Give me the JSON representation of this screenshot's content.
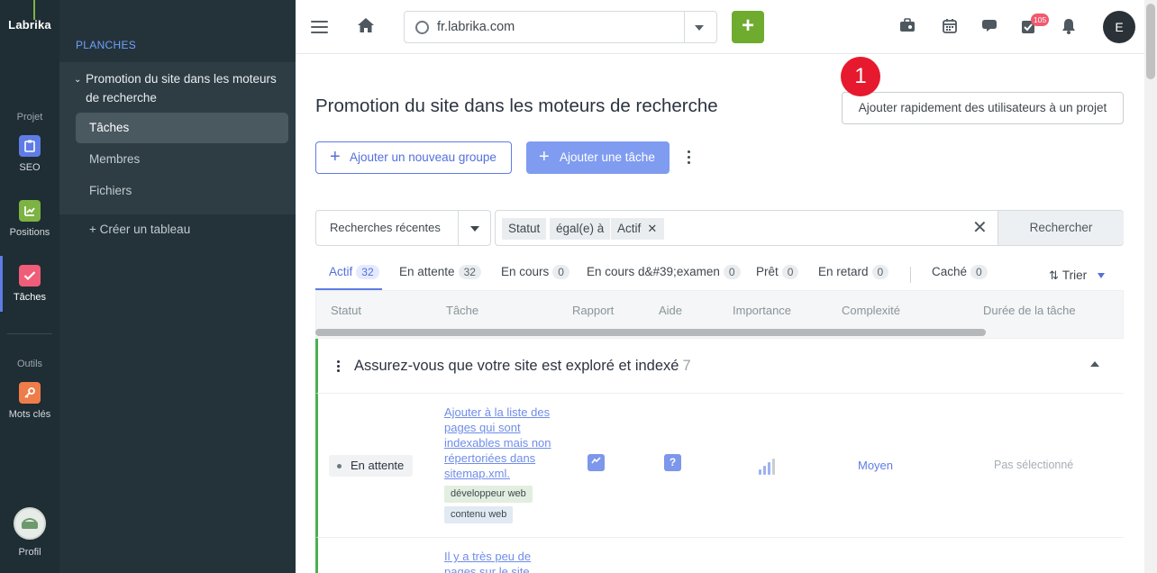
{
  "app": {
    "logo": "Labrika"
  },
  "rail": {
    "section_projet": "Projet",
    "section_outils": "Outils",
    "items": [
      {
        "label": "SEO",
        "color": "#5f7ce6"
      },
      {
        "label": "Positions",
        "color": "#7cb342"
      },
      {
        "label": "Tâches",
        "color": "#ef5d78"
      },
      {
        "label": "Mots clés",
        "color": "#ef7d4a"
      },
      {
        "label": "Profil"
      }
    ]
  },
  "sidebar": {
    "title": "PLANCHES",
    "group_label": "Promotion du site dans les moteurs de recherche",
    "items": [
      {
        "label": "Tâches",
        "active": true
      },
      {
        "label": "Membres"
      },
      {
        "label": "Fichiers"
      }
    ],
    "create_label": "+ Créer un tableau"
  },
  "topbar": {
    "url": "fr.labrika.com",
    "plus_label": "+",
    "notifications_count": "105",
    "user_initial": "E"
  },
  "main": {
    "title": "Promotion du site dans les moteurs de recherche",
    "marker": "1",
    "quick_add_label": "Ajouter rapidement des utilisateurs à un projet",
    "add_group_label": "Ajouter un nouveau groupe",
    "add_task_label": "Ajouter une tâche",
    "recent_searches_label": "Recherches récentes",
    "filter_chips": [
      "Statut",
      "égal(e) à",
      "Actif"
    ],
    "search_label": "Rechercher",
    "tabs": [
      {
        "label": "Actif",
        "count": "32"
      },
      {
        "label": "En attente",
        "count": "32"
      },
      {
        "label": "En cours",
        "count": "0"
      },
      {
        "label": "En cours d&#39;examen",
        "count": "0"
      },
      {
        "label": "Prêt",
        "count": "0"
      },
      {
        "label": "En retard",
        "count": "0"
      },
      {
        "label": "Caché",
        "count": "0"
      }
    ],
    "sort_label": "Trier",
    "columns": [
      "Statut",
      "Tâche",
      "Rapport",
      "Aide",
      "Importance",
      "Complexité",
      "Durée de la tâche"
    ],
    "group": {
      "title": "Assurez-vous que votre site est exploré et indexé",
      "count": "7"
    },
    "rows": [
      {
        "status": "En attente",
        "task": "Ajouter à la liste des pages qui sont indexables mais non répertoriées dans sitemap.xml.",
        "tags": [
          "développeur web",
          "contenu web"
        ],
        "complexity": "Moyen",
        "duration": "Pas sélectionné"
      },
      {
        "task": "Il y a très peu de pages sur le site"
      }
    ]
  }
}
